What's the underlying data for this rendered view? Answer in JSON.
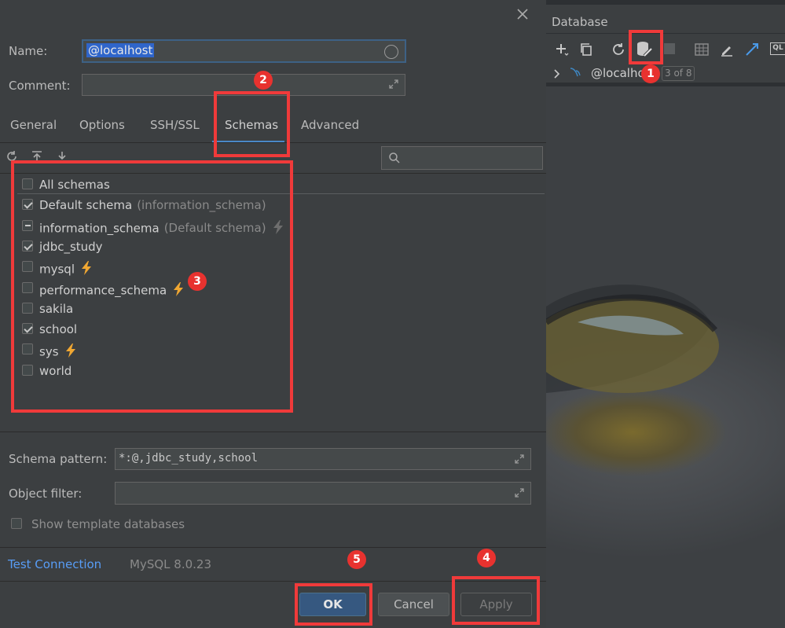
{
  "dialog": {
    "close_icon": "close-icon",
    "name_label": "Name:",
    "name_value": "@localhost",
    "comment_label": "Comment:",
    "tabs": [
      "General",
      "Options",
      "SSH/SSL",
      "Schemas",
      "Advanced"
    ],
    "active_tab": "Schemas",
    "schemas": [
      {
        "name": "All schemas",
        "sub": "",
        "state": "unchecked",
        "bolt": "none"
      },
      {
        "name": "Default schema",
        "sub": "(information_schema)",
        "state": "checked",
        "bolt": "none"
      },
      {
        "name": "information_schema",
        "sub": "(Default schema)",
        "state": "partial",
        "bolt": "gray"
      },
      {
        "name": "jdbc_study",
        "sub": "",
        "state": "checked",
        "bolt": "none"
      },
      {
        "name": "mysql",
        "sub": "",
        "state": "unchecked",
        "bolt": "yellow"
      },
      {
        "name": "performance_schema",
        "sub": "",
        "state": "unchecked",
        "bolt": "yellow"
      },
      {
        "name": "sakila",
        "sub": "",
        "state": "unchecked",
        "bolt": "none"
      },
      {
        "name": "school",
        "sub": "",
        "state": "checked",
        "bolt": "none"
      },
      {
        "name": "sys",
        "sub": "",
        "state": "unchecked",
        "bolt": "yellow"
      },
      {
        "name": "world",
        "sub": "",
        "state": "unchecked",
        "bolt": "none"
      }
    ],
    "schema_pattern_label": "Schema pattern:",
    "schema_pattern_value": "*:@,jdbc_study,school",
    "object_filter_label": "Object filter:",
    "show_template_label": "Show template databases",
    "test_connection": "Test Connection",
    "driver_version": "MySQL 8.0.23",
    "ok_label": "OK",
    "cancel_label": "Cancel",
    "apply_label": "Apply"
  },
  "annotations": [
    "1",
    "2",
    "3",
    "4",
    "5"
  ],
  "database_panel": {
    "title": "Database",
    "tree_item": "@localhost",
    "count_badge": "3 of 8",
    "toolbar_ql": "QL"
  },
  "colors": {
    "accent": "#4a88c7",
    "annotation": "#f03a3a",
    "bolt_yellow": "#f0a732"
  }
}
